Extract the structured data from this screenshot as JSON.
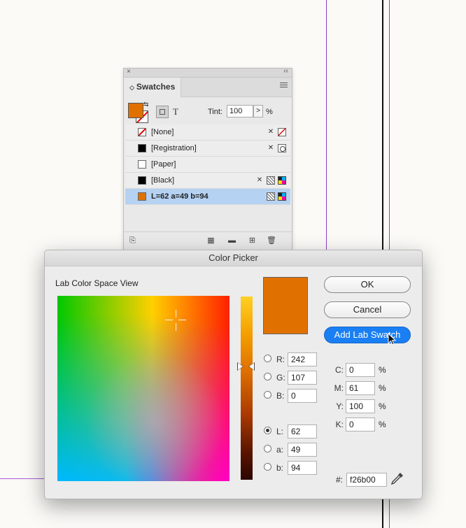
{
  "swatches_panel": {
    "close_glyph": "×",
    "collapse_glyph": "‹‹",
    "tab_label": "Swatches",
    "tint_label": "Tint:",
    "tint_value": "100",
    "tint_percent": "%",
    "stepper_glyph": ">",
    "text_toggle": "T",
    "items": [
      {
        "name": "[None]",
        "chip": "none"
      },
      {
        "name": "[Registration]",
        "chip": "#000000"
      },
      {
        "name": "[Paper]",
        "chip": "#ffffff"
      },
      {
        "name": "[Black]",
        "chip": "#000000"
      },
      {
        "name": "L=62 a=49 b=94",
        "chip": "#e07100",
        "selected": true
      }
    ]
  },
  "color_picker": {
    "title": "Color Picker",
    "view_label": "Lab Color Space View",
    "ok_label": "OK",
    "cancel_label": "Cancel",
    "add_swatch_label": "Add Lab Swatch",
    "preview_color": "#e07100",
    "rgb": {
      "r_label": "R:",
      "r": "242",
      "g_label": "G:",
      "g": "107",
      "b_label": "B:",
      "b": "0"
    },
    "lab": {
      "l_label": "L:",
      "l": "62",
      "a_label": "a:",
      "a": "49",
      "b_label": "b:",
      "b": "94",
      "selected": "L"
    },
    "cmyk": {
      "c_label": "C:",
      "c": "0",
      "m_label": "M:",
      "m": "61",
      "y_label": "Y:",
      "y": "100",
      "k_label": "K:",
      "k": "0",
      "unit": "%"
    },
    "hex_label": "#:",
    "hex_value": "f26b00"
  },
  "colors": {
    "accent": "#1a7ff3",
    "swatch_orange": "#e07100",
    "guide": "#8a3fc9"
  }
}
